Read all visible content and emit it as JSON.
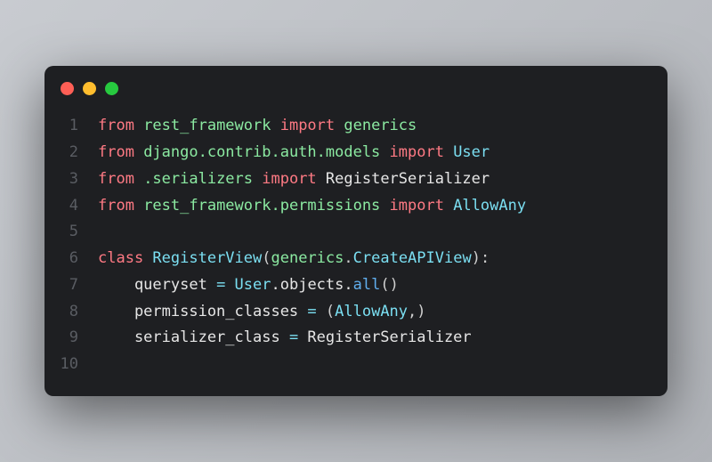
{
  "window": {
    "dots": [
      "red",
      "yellow",
      "green"
    ]
  },
  "code": {
    "lines": [
      {
        "n": "1",
        "tokens": [
          {
            "t": "from ",
            "c": "kw"
          },
          {
            "t": "rest_framework ",
            "c": "mod"
          },
          {
            "t": "import ",
            "c": "kw"
          },
          {
            "t": "generics",
            "c": "mod"
          }
        ]
      },
      {
        "n": "2",
        "tokens": [
          {
            "t": "from ",
            "c": "kw"
          },
          {
            "t": "django.contrib.auth.models ",
            "c": "mod"
          },
          {
            "t": "import ",
            "c": "kw"
          },
          {
            "t": "User",
            "c": "cls"
          }
        ]
      },
      {
        "n": "3",
        "tokens": [
          {
            "t": "from ",
            "c": "kw"
          },
          {
            "t": ".serializers ",
            "c": "mod"
          },
          {
            "t": "import ",
            "c": "kw"
          },
          {
            "t": "RegisterSerializer",
            "c": "txt"
          }
        ]
      },
      {
        "n": "4",
        "tokens": [
          {
            "t": "from ",
            "c": "kw"
          },
          {
            "t": "rest_framework.permissions ",
            "c": "mod"
          },
          {
            "t": "import ",
            "c": "kw"
          },
          {
            "t": "AllowAny",
            "c": "cls"
          }
        ]
      },
      {
        "n": "5",
        "tokens": []
      },
      {
        "n": "6",
        "tokens": [
          {
            "t": "class ",
            "c": "kw"
          },
          {
            "t": "RegisterView",
            "c": "cls"
          },
          {
            "t": "(",
            "c": "punc"
          },
          {
            "t": "generics",
            "c": "mod"
          },
          {
            "t": ".",
            "c": "punc"
          },
          {
            "t": "CreateAPIView",
            "c": "cls"
          },
          {
            "t": "):",
            "c": "punc"
          }
        ]
      },
      {
        "n": "7",
        "tokens": [
          {
            "t": "    queryset ",
            "c": "txt"
          },
          {
            "t": "= ",
            "c": "op"
          },
          {
            "t": "User",
            "c": "cls"
          },
          {
            "t": ".objects.",
            "c": "txt"
          },
          {
            "t": "all",
            "c": "fn"
          },
          {
            "t": "()",
            "c": "punc"
          }
        ]
      },
      {
        "n": "8",
        "tokens": [
          {
            "t": "    permission_classes ",
            "c": "txt"
          },
          {
            "t": "= ",
            "c": "op"
          },
          {
            "t": "(",
            "c": "punc"
          },
          {
            "t": "AllowAny",
            "c": "cls"
          },
          {
            "t": ",)",
            "c": "punc"
          }
        ]
      },
      {
        "n": "9",
        "tokens": [
          {
            "t": "    serializer_class ",
            "c": "txt"
          },
          {
            "t": "= ",
            "c": "op"
          },
          {
            "t": "RegisterSerializer",
            "c": "txt"
          }
        ]
      },
      {
        "n": "10",
        "tokens": []
      }
    ]
  }
}
